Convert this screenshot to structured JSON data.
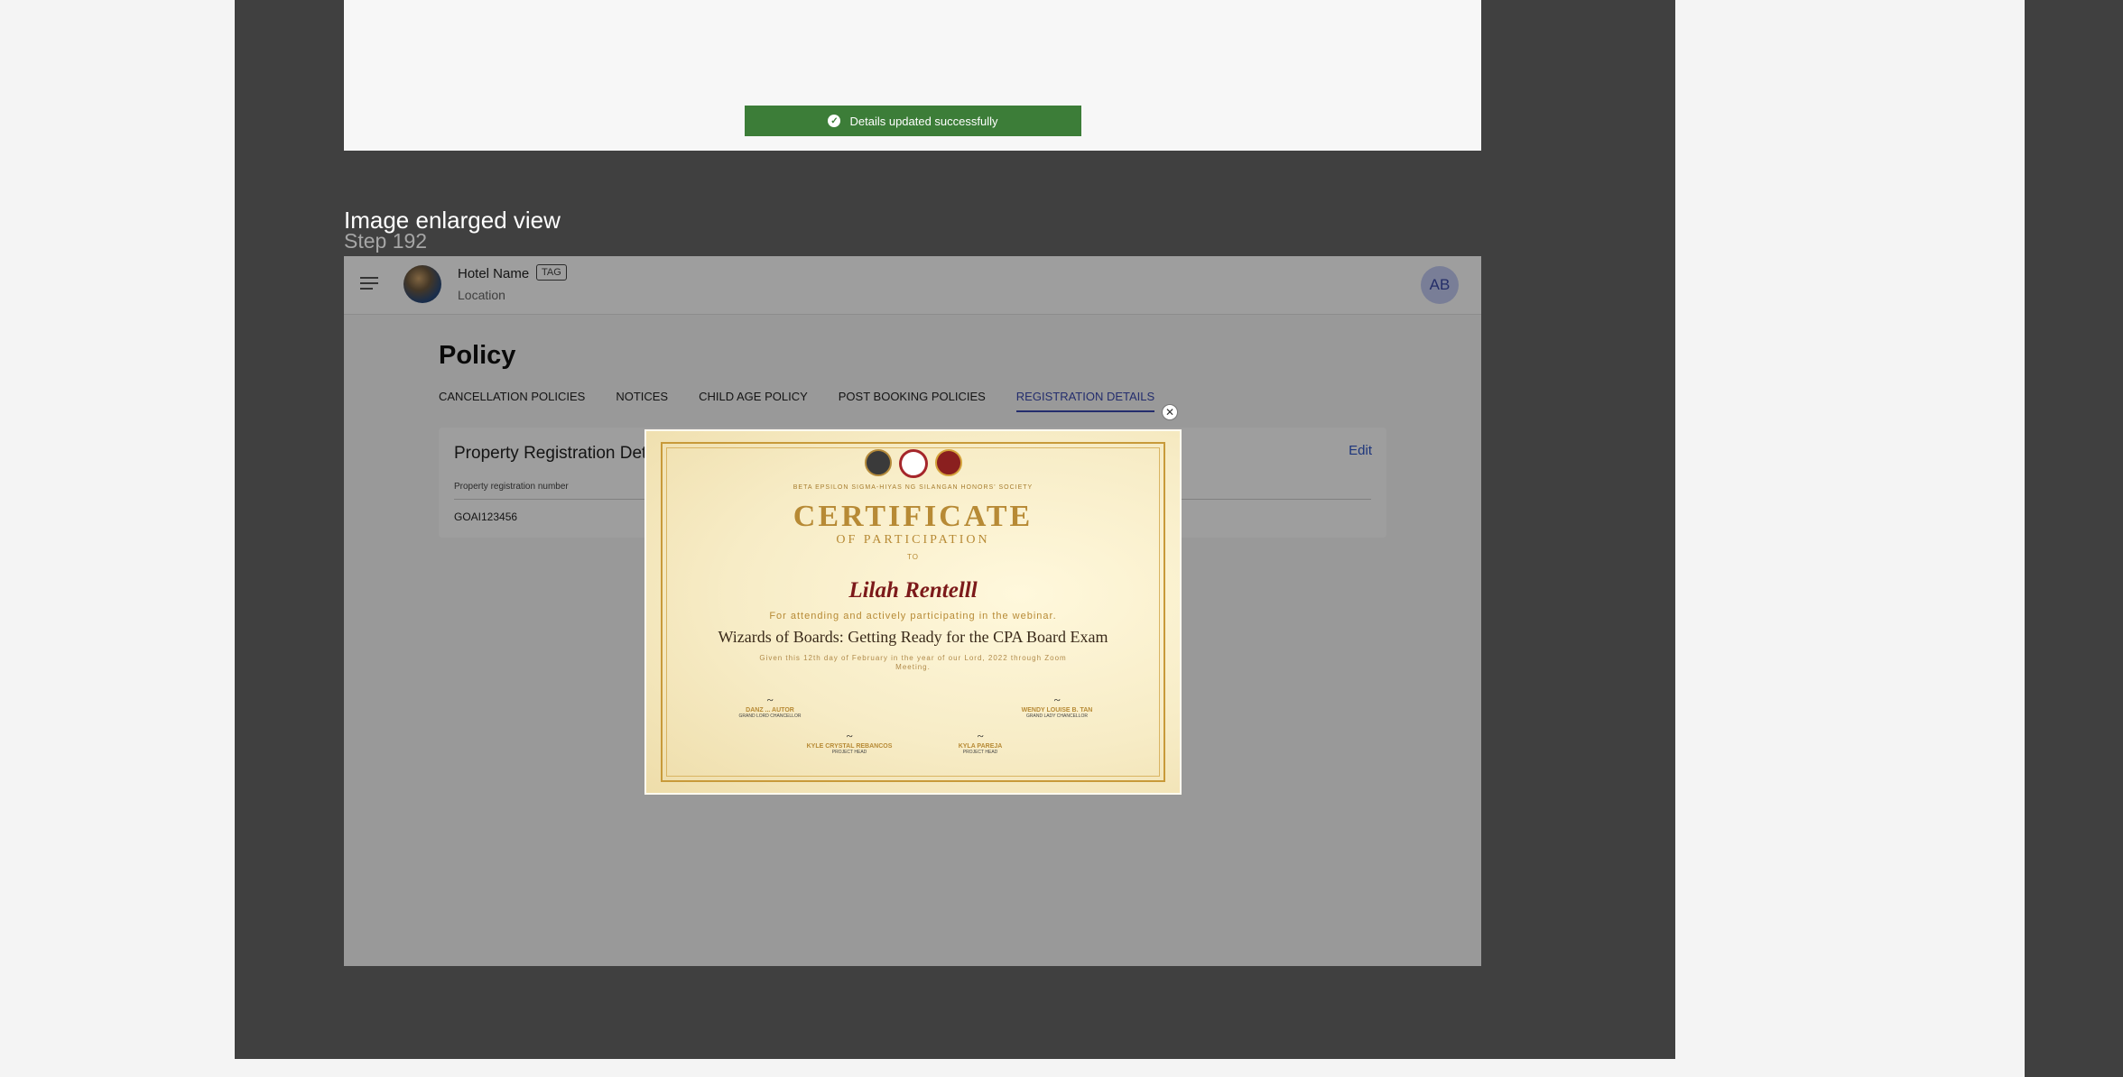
{
  "toast": {
    "message": "Details updated successfully",
    "icon": "check-circle-icon",
    "color": "#3c7d38"
  },
  "caption": {
    "title": "Image enlarged view",
    "step": "Step 192"
  },
  "appbar": {
    "hotel_name": "Hotel Name",
    "tag": "TAG",
    "location": "Location",
    "user_initials": "AB"
  },
  "page": {
    "title": "Policy"
  },
  "tabs": [
    {
      "label": "CANCELLATION POLICIES"
    },
    {
      "label": "NOTICES"
    },
    {
      "label": "CHILD AGE POLICY"
    },
    {
      "label": "POST BOOKING POLICIES"
    },
    {
      "label": "REGISTRATION DETAILS"
    }
  ],
  "card": {
    "title": "Property Registration Det",
    "edit_label": "Edit",
    "column_header": "Property registration number",
    "column_value": "GOAI123456"
  },
  "modal": {
    "close_icon": "close-icon"
  },
  "certificate": {
    "society": "BETA EPSILON SIGMA-HIYAS NG SILANGAN HONORS' SOCIETY",
    "heading": "CERTIFICATE",
    "subheading": "OF PARTICIPATION",
    "to": "TO",
    "recipient": "Lilah Rentelll",
    "line1": "For attending and actively participating in the webinar.",
    "webinar": "Wizards of Boards: Getting Ready for the CPA Board Exam",
    "given1": "Given this 12th day of February in the year of our Lord, 2022 through Zoom",
    "given2": "Meeting.",
    "signatories": [
      {
        "name": "DANZ ... AUTOR",
        "role": "GRAND LORD CHANCELLOR"
      },
      {
        "name": "WENDY LOUISE B. TAN",
        "role": "GRAND LADY CHANCELLOR"
      },
      {
        "name": "KYLE CRYSTAL REBANCOS",
        "role": "PROJECT HEAD"
      },
      {
        "name": "KYLA PAREJA",
        "role": "PROJECT HEAD"
      }
    ]
  }
}
